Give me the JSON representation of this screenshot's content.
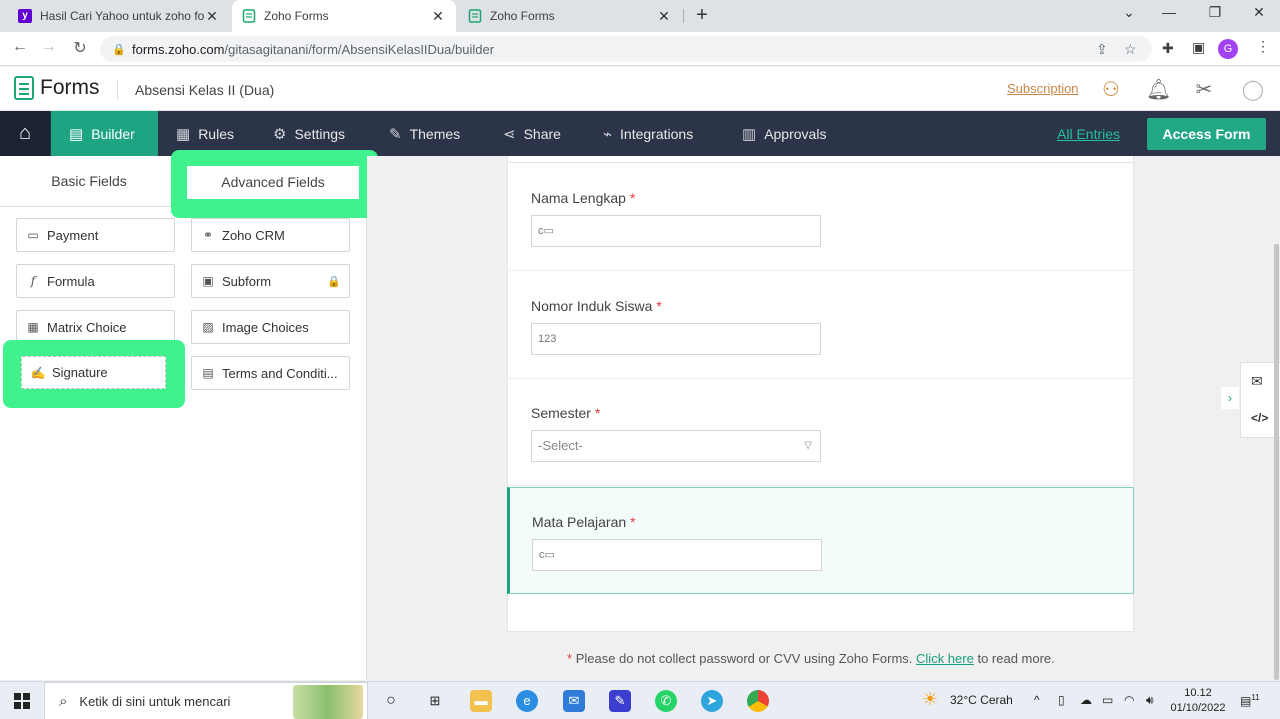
{
  "browser": {
    "tabs": [
      {
        "title": "Hasil Cari Yahoo untuk zoho form",
        "favicon": "yahoo-icon",
        "close": "✕"
      },
      {
        "title": "Zoho Forms",
        "favicon": "zoho-forms-icon",
        "close": "✕"
      },
      {
        "title": "Zoho Forms",
        "favicon": "zoho-forms-icon",
        "close": "✕"
      }
    ],
    "url_host": "forms.zoho.com",
    "url_path": "/gitasagitanani/form/AbsensiKelasIIDua/builder",
    "profile_initial": "G"
  },
  "header": {
    "app_name": "Forms",
    "form_name": "Absensi Kelas II (Dua)",
    "subscription": "Subscription"
  },
  "nav": {
    "builder": "Builder",
    "rules": "Rules",
    "settings": "Settings",
    "themes": "Themes",
    "share": "Share",
    "integrations": "Integrations",
    "approvals": "Approvals",
    "all_entries": "All Entries",
    "access_form": "Access Form"
  },
  "panel": {
    "tab_basic": "Basic Fields",
    "tab_advanced": "Advanced Fields",
    "fields": [
      {
        "label": "Payment",
        "icon": "card-icon"
      },
      {
        "label": "Zoho CRM",
        "icon": "handshake-icon"
      },
      {
        "label": "Formula",
        "icon": "fx-icon"
      },
      {
        "label": "Subform",
        "icon": "subform-icon",
        "locked": true
      },
      {
        "label": "Matrix Choice",
        "icon": "grid-icon"
      },
      {
        "label": "Image Choices",
        "icon": "image-icon"
      },
      {
        "label": "Signature",
        "icon": "pen-icon"
      },
      {
        "label": "Terms and Conditi...",
        "icon": "document-icon"
      }
    ]
  },
  "form": {
    "fields": [
      {
        "label": "Nama Lengkap",
        "required": "*",
        "placeholder": "",
        "icon": "text-field-icon"
      },
      {
        "label": "Nomor Induk Siswa",
        "required": "*",
        "placeholder": "123",
        "icon": "number-icon"
      },
      {
        "label": "Semester",
        "required": "*",
        "placeholder": "-Select-",
        "icon": "dropdown-icon"
      },
      {
        "label": "Mata Pelajaran",
        "required": "*",
        "placeholder": "",
        "icon": "text-field-icon"
      }
    ],
    "footnote_star": "*",
    "footnote_text": "Please do not collect password or CVV using Zoho Forms.",
    "footnote_link": "Click here",
    "footnote_tail": "to read more."
  },
  "taskbar": {
    "search_placeholder": "Ketik di sini untuk mencari",
    "weather": "32°C  Cerah",
    "time": "10.12",
    "date": "01/10/2022",
    "notif_count": "11"
  },
  "colors": {
    "accent": "#1fa483",
    "highlight": "#3ff28d",
    "nav_bg": "#2b3448",
    "required": "#e03b3b"
  }
}
